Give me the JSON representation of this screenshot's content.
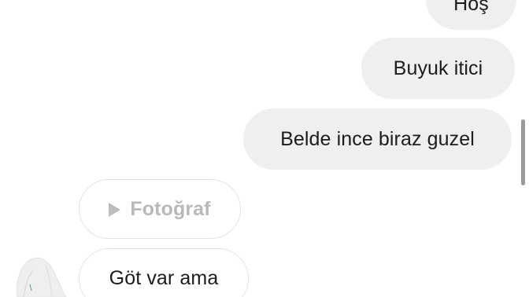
{
  "messages": {
    "top_partial": "Hoş",
    "sent_1": "Buyuk itici",
    "sent_2": "Belde ince biraz guzel",
    "received_photo": "Fotoğraf",
    "received_1": "Göt var ama"
  },
  "icons": {
    "photo_play": "play-icon",
    "avatar": "avatar-icon"
  },
  "colors": {
    "sent_bubble": "#efefef",
    "received_border": "#e3e3e3",
    "photo_text": "#b9b9b9",
    "text": "#1c1c1c"
  }
}
